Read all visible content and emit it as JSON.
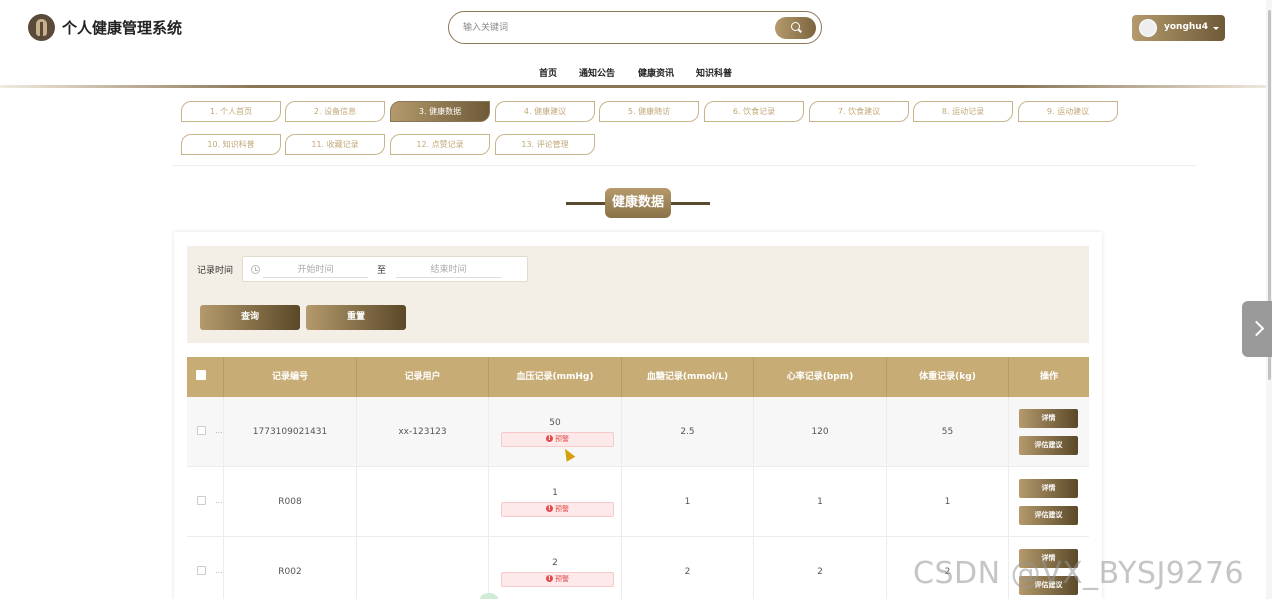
{
  "header": {
    "app_title": "个人健康管理系统",
    "search": {
      "placeholder": "输入关键词"
    },
    "user": {
      "name": "yonghu4"
    }
  },
  "nav": [
    "首页",
    "通知公告",
    "健康资讯",
    "知识科普"
  ],
  "tabs": [
    "1. 个人首页",
    "2. 设备信息",
    "3. 健康数据",
    "4. 健康建议",
    "5. 健康随访",
    "6. 饮食记录",
    "7. 饮食建议",
    "8. 运动记录",
    "9. 运动建议",
    "10. 知识科普",
    "11. 收藏记录",
    "12. 点赞记录",
    "13. 评论管理"
  ],
  "active_tab": "3. 健康数据",
  "section_title": "健康数据",
  "filter": {
    "label": "记录时间",
    "start_placeholder": "开始时间",
    "separator": "至",
    "end_placeholder": "结束时间",
    "query_label": "查询",
    "reset_label": "重置"
  },
  "table": {
    "headers": [
      "记录编号",
      "记录用户",
      "血压记录(mmHg)",
      "血糖记录(mmol/L)",
      "心率记录(bpm)",
      "体重记录(kg)",
      "操作"
    ],
    "warning_label": "预警",
    "detail_label": "详情",
    "assess_label": "评估建议",
    "rows": [
      {
        "id": "1773109021431",
        "user": "xx-123123",
        "bp": "50",
        "glucose": "2.5",
        "heart_rate": "120",
        "weight": "55"
      },
      {
        "id": "R008",
        "user": "",
        "bp": "1",
        "glucose": "1",
        "heart_rate": "1",
        "weight": "1"
      },
      {
        "id": "R002",
        "user": "",
        "bp": "2",
        "glucose": "2",
        "heart_rate": "2",
        "weight": "2"
      }
    ]
  },
  "watermark": "CSDN @VX_BYSJ9276",
  "colors": {
    "accent": "#b49a6c",
    "accent_dark": "#5a4828",
    "header_row": "#c8ac76",
    "warning": "#e24a4a"
  }
}
